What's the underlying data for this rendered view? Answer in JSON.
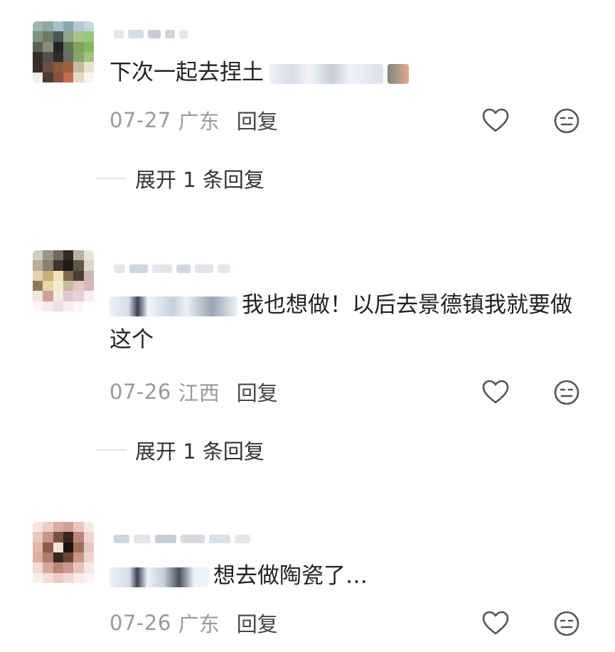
{
  "comments": [
    {
      "text": "下次一起去捏土",
      "date": "07-27",
      "location": "广东",
      "reply_label": "回复",
      "expand_label": "展开 1 条回复",
      "avatar_colors": [
        "#9fb3b0",
        "#90a8a0",
        "#a4c0c8",
        "#86a6b0",
        "#b7c8d3",
        "#c7d7df",
        "#7e9180",
        "#6e7b66",
        "#4b5652",
        "#93a28a",
        "#a7c38b",
        "#9ac77a",
        "#5d6152",
        "#8e8b7a",
        "#222427",
        "#62745a",
        "#7ea45a",
        "#84b85a",
        "#30302e",
        "#505148",
        "#2b2c2d",
        "#6b6c60",
        "#8aa66a",
        "#a6c07d",
        "#3a2e2c",
        "#6b4f48",
        "#8a5a3e",
        "#a06040",
        "#c8b9a0",
        "#e8e0d0",
        "#f0ece5",
        "#4a3a30",
        "#8a5040",
        "#c07050",
        "#e8d8c8",
        "#f8f4f0"
      ]
    },
    {
      "text": "我也想做！以后去景德镇我就要做这个",
      "date": "07-26",
      "location": "江西",
      "reply_label": "回复",
      "expand_label": "展开 1 条回复",
      "avatar_colors": [
        "#d0cfc6",
        "#9c9386",
        "#6e6a60",
        "#2e2a24",
        "#b7b0a3",
        "#e8e3da",
        "#b9ad9a",
        "#8a7f70",
        "#3b352d",
        "#1e1b18",
        "#5f5648",
        "#dcd6cc",
        "#e2d2b0",
        "#c9b07a",
        "#f0e1b8",
        "#7a6a50",
        "#4a3f33",
        "#c7b9b1",
        "#8f7a58",
        "#e5d7a8",
        "#f3ead0",
        "#c9bba0",
        "#e8c6c4",
        "#d8b5b8",
        "#f0e6dd",
        "#caa296",
        "#f5eae4",
        "#e2c8cf",
        "#e8d2d8",
        "#f6eef0",
        "#fbf7f6",
        "#f4eaea",
        "#efe0e4",
        "#f7eef1",
        "#fbf6f7",
        "#ffffff"
      ]
    },
    {
      "text": "想去做陶瓷了…",
      "date": "07-26",
      "location": "广东",
      "reply_label": "回复",
      "avatar_colors": [
        "#f4e6e2",
        "#e9cfc6",
        "#d9aea2",
        "#cfa294",
        "#e6c8c0",
        "#f5e9e6",
        "#e8c9bf",
        "#c99584",
        "#7a5244",
        "#3c2620",
        "#b98677",
        "#edd6cf",
        "#e2b8aa",
        "#8b5b4b",
        "#f3e4da",
        "#1c120f",
        "#a06c5c",
        "#e6c7bd",
        "#dcae9f",
        "#b27d6d",
        "#3a261f",
        "#6d4538",
        "#c8978a",
        "#edd5cd",
        "#f0dcd5",
        "#d6a99b",
        "#b98677",
        "#c99a8b",
        "#e7c6bc",
        "#f5e8e3",
        "#f8efec",
        "#f1dfd9",
        "#e9cdc4",
        "#efd9d2",
        "#f6ebe7",
        "#fbf5f3"
      ]
    }
  ],
  "icons": {
    "like": "heart-outline-icon",
    "emoji": "neutral-face-icon"
  },
  "colors": {
    "text": "#222222",
    "meta": "#9a9a9a",
    "reply": "#444444",
    "icon": "#555555"
  }
}
